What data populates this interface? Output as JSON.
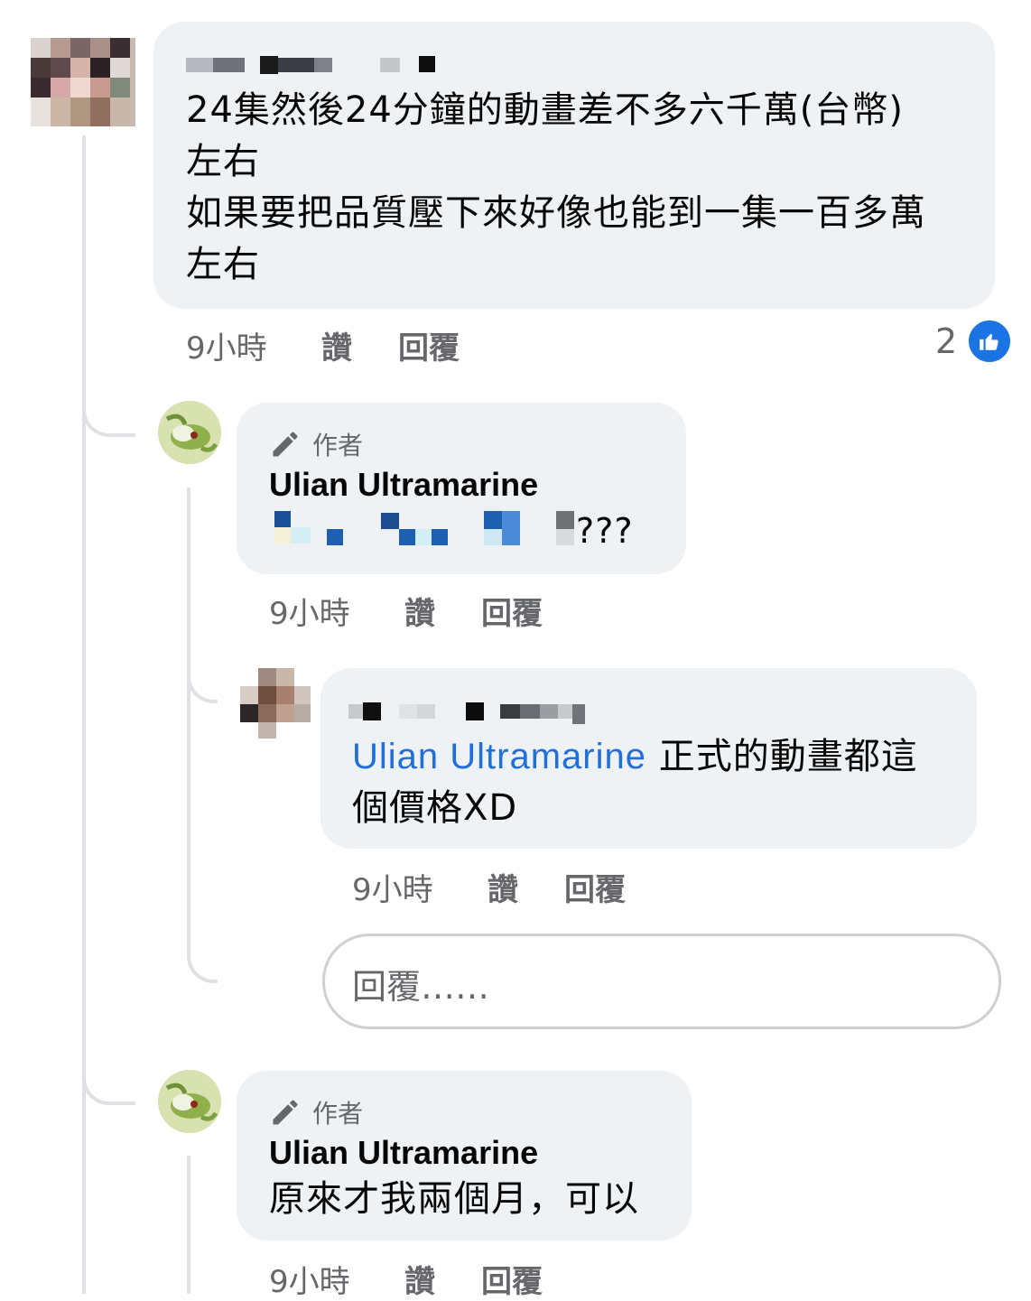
{
  "comments": [
    {
      "id": "c1",
      "name_visible": false,
      "lines": [
        "24集然後24分鐘的動畫差不多六千萬(台幣)",
        "左右",
        "如果要把品質壓下來好像也能到一集一百多萬",
        "左右"
      ],
      "meta": {
        "time": "9小時",
        "like": "讚",
        "reply": "回覆"
      },
      "reaction_count": "2",
      "reaction_icon": "like-icon"
    },
    {
      "id": "c2",
      "author_badge": "作者",
      "author_name": "Ulian Ultramarine",
      "text_suffix": "???",
      "meta": {
        "time": "9小時",
        "like": "讚",
        "reply": "回覆"
      }
    },
    {
      "id": "c3",
      "mention": "Ulian Ultramarine",
      "text_line1": " 正式的動畫都這",
      "text_line2": "個價格XD",
      "meta": {
        "time": "9小時",
        "like": "讚",
        "reply": "回覆"
      }
    },
    {
      "id": "c4",
      "author_badge": "作者",
      "author_name": "Ulian Ultramarine",
      "text": "原來才我兩個月，可以",
      "meta": {
        "time": "9小時",
        "like": "讚",
        "reply": "回覆"
      }
    }
  ],
  "reply_input": {
    "placeholder": "回覆……"
  },
  "colors": {
    "bubble": "#eff2f5",
    "mention": "#216fdb",
    "like_badge": "#1b74e4",
    "meta": "#65676b"
  }
}
